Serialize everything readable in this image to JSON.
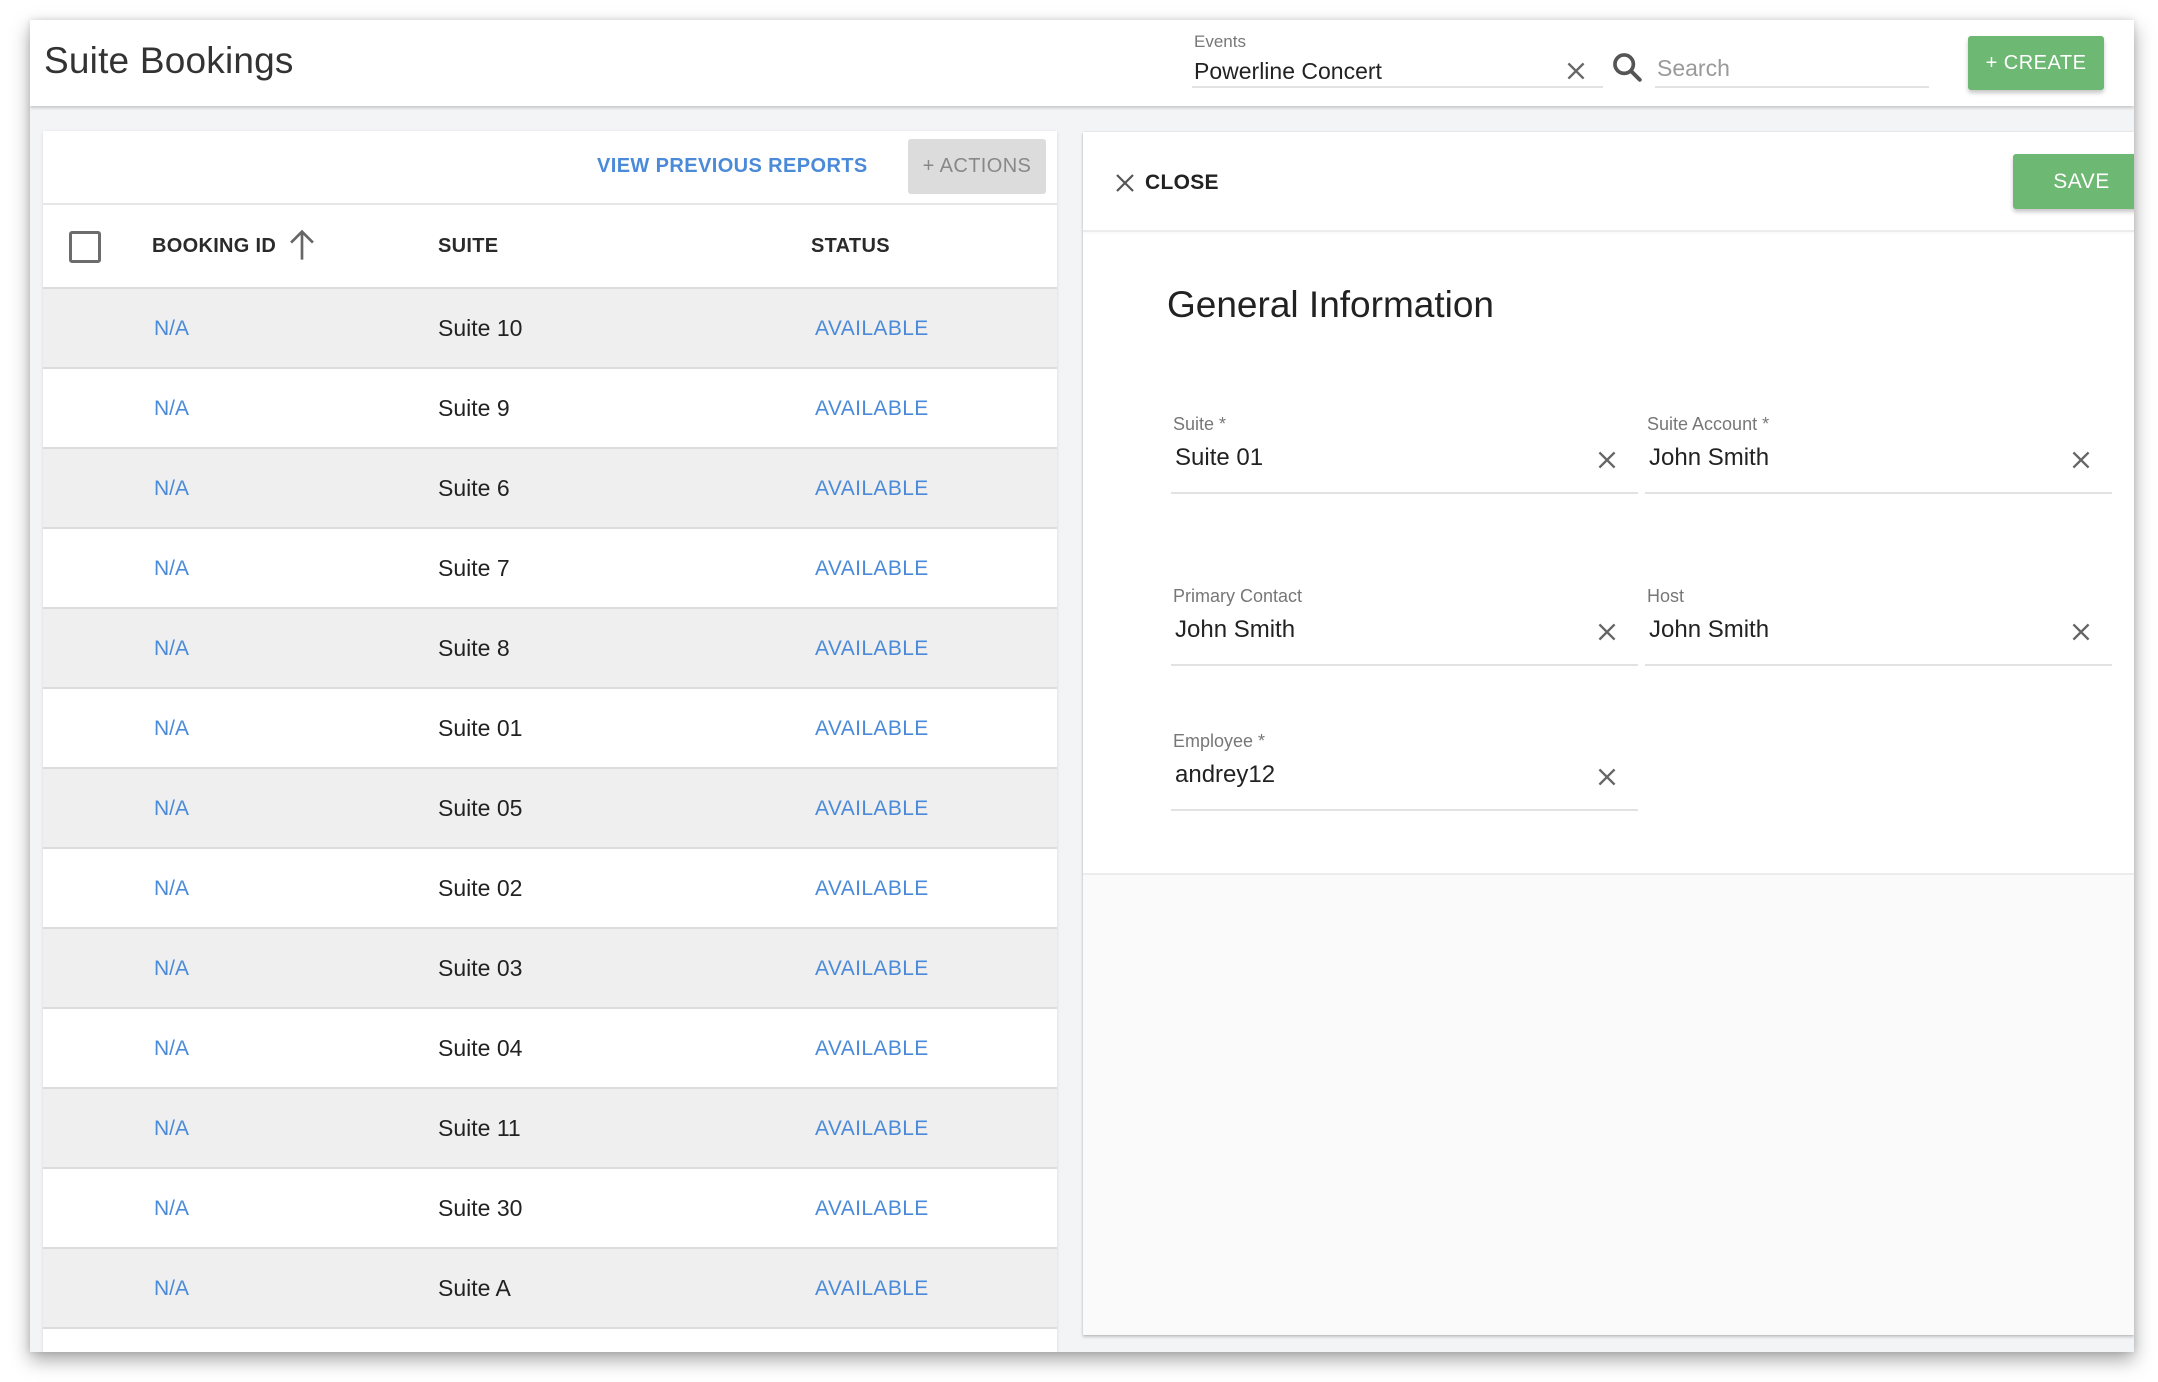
{
  "header": {
    "title": "Suite Bookings",
    "events_filter": {
      "label": "Events",
      "value": "Powerline Concert"
    },
    "search": {
      "placeholder": "Search",
      "value": ""
    },
    "create_label": "+ CREATE"
  },
  "list": {
    "view_reports_label": "VIEW PREVIOUS REPORTS",
    "actions_label": "+ ACTIONS",
    "columns": [
      "BOOKING ID",
      "SUITE",
      "STATUS"
    ],
    "sort": {
      "column": "BOOKING ID",
      "direction": "ascending"
    },
    "rows": [
      {
        "booking_id": "N/A",
        "suite": "Suite 10",
        "status": "AVAILABLE"
      },
      {
        "booking_id": "N/A",
        "suite": "Suite 9",
        "status": "AVAILABLE"
      },
      {
        "booking_id": "N/A",
        "suite": "Suite 6",
        "status": "AVAILABLE"
      },
      {
        "booking_id": "N/A",
        "suite": "Suite 7",
        "status": "AVAILABLE"
      },
      {
        "booking_id": "N/A",
        "suite": "Suite 8",
        "status": "AVAILABLE"
      },
      {
        "booking_id": "N/A",
        "suite": "Suite 01",
        "status": "AVAILABLE"
      },
      {
        "booking_id": "N/A",
        "suite": "Suite 05",
        "status": "AVAILABLE"
      },
      {
        "booking_id": "N/A",
        "suite": "Suite 02",
        "status": "AVAILABLE"
      },
      {
        "booking_id": "N/A",
        "suite": "Suite 03",
        "status": "AVAILABLE"
      },
      {
        "booking_id": "N/A",
        "suite": "Suite 04",
        "status": "AVAILABLE"
      },
      {
        "booking_id": "N/A",
        "suite": "Suite 11",
        "status": "AVAILABLE"
      },
      {
        "booking_id": "N/A",
        "suite": "Suite 30",
        "status": "AVAILABLE"
      },
      {
        "booking_id": "N/A",
        "suite": "Suite A",
        "status": "AVAILABLE"
      }
    ]
  },
  "detail": {
    "close_label": "CLOSE",
    "save_label": "SAVE",
    "section_title": "General Information",
    "fields": {
      "suite": {
        "label": "Suite *",
        "value": "Suite 01"
      },
      "suite_account": {
        "label": "Suite Account *",
        "value": "John Smith"
      },
      "primary_contact": {
        "label": "Primary Contact",
        "value": "John Smith"
      },
      "host": {
        "label": "Host",
        "value": "John Smith"
      },
      "employee": {
        "label": "Employee *",
        "value": "andrey12"
      }
    }
  },
  "colors": {
    "accent_green": "#6db872",
    "link_blue": "#4a8ad8",
    "row_alt": "#efefef"
  }
}
